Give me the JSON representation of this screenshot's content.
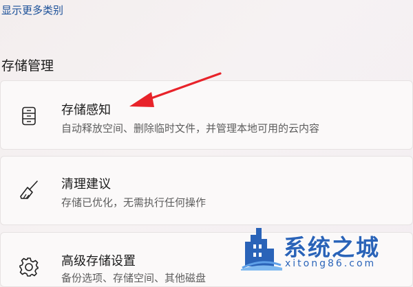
{
  "links": {
    "show_more": "显示更多类别"
  },
  "section": {
    "title": "存储管理"
  },
  "cards": [
    {
      "title": "存储感知",
      "desc": "自动释放空间、删除临时文件，并管理本地可用的云内容",
      "icon": "storage-drive-icon"
    },
    {
      "title": "清理建议",
      "desc": "存储已优化，无需执行任何操作",
      "icon": "broom-icon"
    },
    {
      "title": "高级存储设置",
      "desc": "备份选项、存储空间、其他磁盘",
      "icon": "gear-icon"
    }
  ],
  "annotation": {
    "arrow_color": "#e8232a"
  },
  "watermark": {
    "name": "系统之城",
    "url": "xitong86.com",
    "color": "#2a63b8"
  }
}
